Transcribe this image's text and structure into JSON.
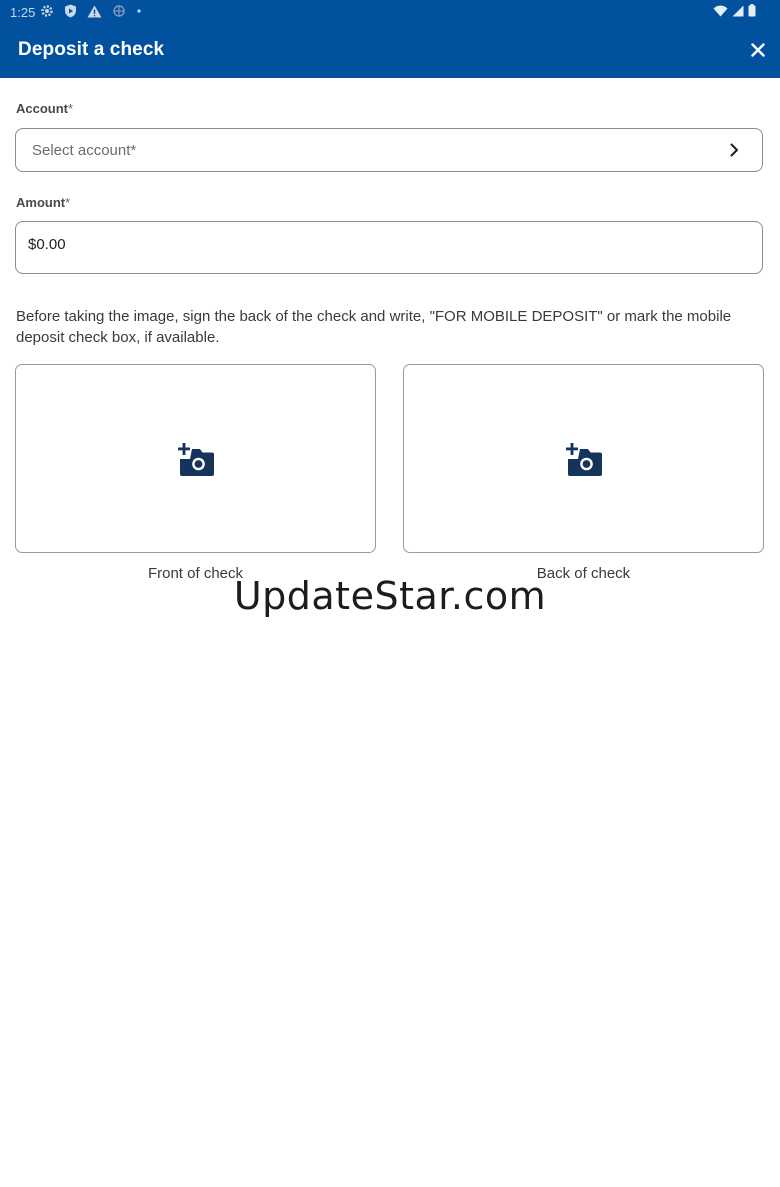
{
  "status_bar": {
    "time": "1:25",
    "left_icons": [
      "gear-icon",
      "shield-play-icon",
      "warning-icon",
      "network-icon",
      "dot-icon"
    ],
    "right_icons": [
      "wifi-icon",
      "cellular-icon",
      "battery-icon"
    ]
  },
  "header": {
    "title": "Deposit a check",
    "close_icon": "close-icon",
    "background": "#02519e"
  },
  "account": {
    "label": "Account",
    "required_mark": "*",
    "placeholder": "Select account*",
    "chevron_icon": "chevron-right-icon"
  },
  "amount": {
    "label": "Amount",
    "required_mark": "*",
    "value": "$0.00"
  },
  "instructions": "Before taking the image, sign the back of the check and write, \"FOR MOBILE DEPOSIT\" or mark the mobile deposit check box, if available.",
  "checks": {
    "front_caption": "Front of check",
    "back_caption": "Back of check",
    "icon": "add-camera-icon",
    "icon_color": "#16335c"
  },
  "watermark": "UpdateStar.com"
}
